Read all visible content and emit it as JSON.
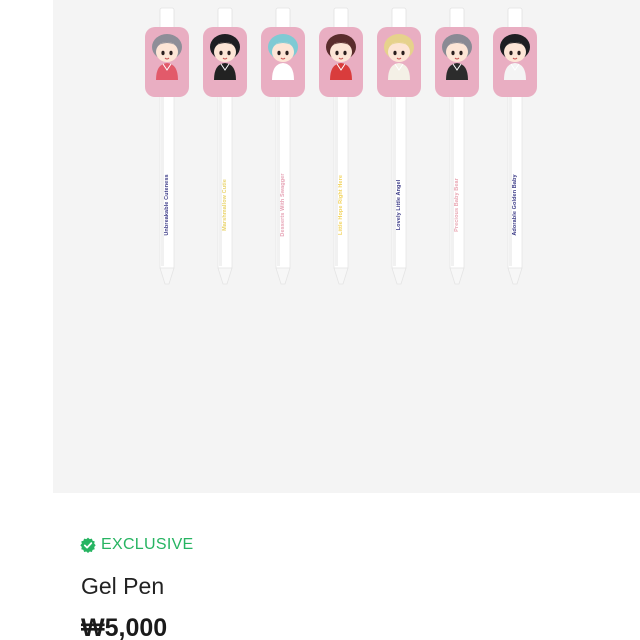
{
  "product": {
    "badge": "EXCLUSIVE",
    "badge_icon": "verified-check-icon",
    "badge_color": "#27b462",
    "name": "Gel Pen",
    "price": "₩5,000"
  },
  "pens": [
    {
      "text": "Unbreakable Cuteness",
      "color": "#3b3a86",
      "accent": "#e25a6a",
      "hair": "#8e8e98"
    },
    {
      "text": "Marshmallow Cutie",
      "color": "#e9d36a",
      "accent": "#222222",
      "hair": "#1e1e22"
    },
    {
      "text": "Desserts With Swagger",
      "color": "#e6a2b4",
      "accent": "#ffffff",
      "hair": "#7fcad4"
    },
    {
      "text": "Little Hope Right Here",
      "color": "#f2d35b",
      "accent": "#d93c3c",
      "hair": "#5a2c2c"
    },
    {
      "text": "Lovely Little Angel",
      "color": "#3b3a86",
      "accent": "#f4f0e6",
      "hair": "#e6d28c"
    },
    {
      "text": "Precious Baby Bear",
      "color": "#e9a6b2",
      "accent": "#2c2c2c",
      "hair": "#8a8a94"
    },
    {
      "text": "Adorable Golden Baby",
      "color": "#3b3a86",
      "accent": "#f4f4f4",
      "hair": "#1e1e22"
    }
  ]
}
